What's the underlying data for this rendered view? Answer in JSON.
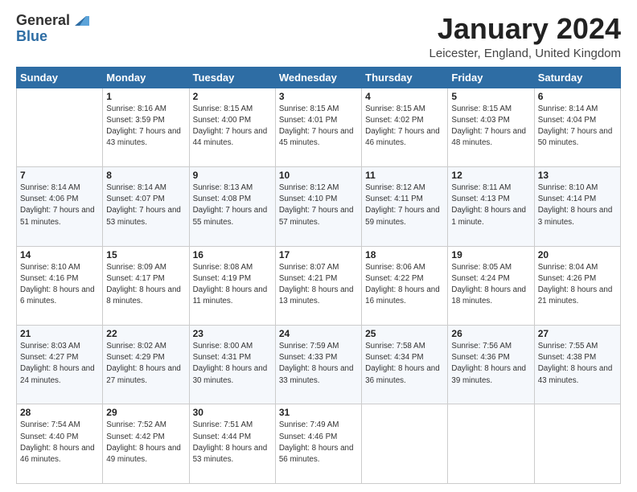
{
  "header": {
    "logo_general": "General",
    "logo_blue": "Blue",
    "month_title": "January 2024",
    "location": "Leicester, England, United Kingdom"
  },
  "weekdays": [
    "Sunday",
    "Monday",
    "Tuesday",
    "Wednesday",
    "Thursday",
    "Friday",
    "Saturday"
  ],
  "weeks": [
    [
      {
        "day": "",
        "sunrise": "",
        "sunset": "",
        "daylight": ""
      },
      {
        "day": "1",
        "sunrise": "Sunrise: 8:16 AM",
        "sunset": "Sunset: 3:59 PM",
        "daylight": "Daylight: 7 hours and 43 minutes."
      },
      {
        "day": "2",
        "sunrise": "Sunrise: 8:15 AM",
        "sunset": "Sunset: 4:00 PM",
        "daylight": "Daylight: 7 hours and 44 minutes."
      },
      {
        "day": "3",
        "sunrise": "Sunrise: 8:15 AM",
        "sunset": "Sunset: 4:01 PM",
        "daylight": "Daylight: 7 hours and 45 minutes."
      },
      {
        "day": "4",
        "sunrise": "Sunrise: 8:15 AM",
        "sunset": "Sunset: 4:02 PM",
        "daylight": "Daylight: 7 hours and 46 minutes."
      },
      {
        "day": "5",
        "sunrise": "Sunrise: 8:15 AM",
        "sunset": "Sunset: 4:03 PM",
        "daylight": "Daylight: 7 hours and 48 minutes."
      },
      {
        "day": "6",
        "sunrise": "Sunrise: 8:14 AM",
        "sunset": "Sunset: 4:04 PM",
        "daylight": "Daylight: 7 hours and 50 minutes."
      }
    ],
    [
      {
        "day": "7",
        "sunrise": "Sunrise: 8:14 AM",
        "sunset": "Sunset: 4:06 PM",
        "daylight": "Daylight: 7 hours and 51 minutes."
      },
      {
        "day": "8",
        "sunrise": "Sunrise: 8:14 AM",
        "sunset": "Sunset: 4:07 PM",
        "daylight": "Daylight: 7 hours and 53 minutes."
      },
      {
        "day": "9",
        "sunrise": "Sunrise: 8:13 AM",
        "sunset": "Sunset: 4:08 PM",
        "daylight": "Daylight: 7 hours and 55 minutes."
      },
      {
        "day": "10",
        "sunrise": "Sunrise: 8:12 AM",
        "sunset": "Sunset: 4:10 PM",
        "daylight": "Daylight: 7 hours and 57 minutes."
      },
      {
        "day": "11",
        "sunrise": "Sunrise: 8:12 AM",
        "sunset": "Sunset: 4:11 PM",
        "daylight": "Daylight: 7 hours and 59 minutes."
      },
      {
        "day": "12",
        "sunrise": "Sunrise: 8:11 AM",
        "sunset": "Sunset: 4:13 PM",
        "daylight": "Daylight: 8 hours and 1 minute."
      },
      {
        "day": "13",
        "sunrise": "Sunrise: 8:10 AM",
        "sunset": "Sunset: 4:14 PM",
        "daylight": "Daylight: 8 hours and 3 minutes."
      }
    ],
    [
      {
        "day": "14",
        "sunrise": "Sunrise: 8:10 AM",
        "sunset": "Sunset: 4:16 PM",
        "daylight": "Daylight: 8 hours and 6 minutes."
      },
      {
        "day": "15",
        "sunrise": "Sunrise: 8:09 AM",
        "sunset": "Sunset: 4:17 PM",
        "daylight": "Daylight: 8 hours and 8 minutes."
      },
      {
        "day": "16",
        "sunrise": "Sunrise: 8:08 AM",
        "sunset": "Sunset: 4:19 PM",
        "daylight": "Daylight: 8 hours and 11 minutes."
      },
      {
        "day": "17",
        "sunrise": "Sunrise: 8:07 AM",
        "sunset": "Sunset: 4:21 PM",
        "daylight": "Daylight: 8 hours and 13 minutes."
      },
      {
        "day": "18",
        "sunrise": "Sunrise: 8:06 AM",
        "sunset": "Sunset: 4:22 PM",
        "daylight": "Daylight: 8 hours and 16 minutes."
      },
      {
        "day": "19",
        "sunrise": "Sunrise: 8:05 AM",
        "sunset": "Sunset: 4:24 PM",
        "daylight": "Daylight: 8 hours and 18 minutes."
      },
      {
        "day": "20",
        "sunrise": "Sunrise: 8:04 AM",
        "sunset": "Sunset: 4:26 PM",
        "daylight": "Daylight: 8 hours and 21 minutes."
      }
    ],
    [
      {
        "day": "21",
        "sunrise": "Sunrise: 8:03 AM",
        "sunset": "Sunset: 4:27 PM",
        "daylight": "Daylight: 8 hours and 24 minutes."
      },
      {
        "day": "22",
        "sunrise": "Sunrise: 8:02 AM",
        "sunset": "Sunset: 4:29 PM",
        "daylight": "Daylight: 8 hours and 27 minutes."
      },
      {
        "day": "23",
        "sunrise": "Sunrise: 8:00 AM",
        "sunset": "Sunset: 4:31 PM",
        "daylight": "Daylight: 8 hours and 30 minutes."
      },
      {
        "day": "24",
        "sunrise": "Sunrise: 7:59 AM",
        "sunset": "Sunset: 4:33 PM",
        "daylight": "Daylight: 8 hours and 33 minutes."
      },
      {
        "day": "25",
        "sunrise": "Sunrise: 7:58 AM",
        "sunset": "Sunset: 4:34 PM",
        "daylight": "Daylight: 8 hours and 36 minutes."
      },
      {
        "day": "26",
        "sunrise": "Sunrise: 7:56 AM",
        "sunset": "Sunset: 4:36 PM",
        "daylight": "Daylight: 8 hours and 39 minutes."
      },
      {
        "day": "27",
        "sunrise": "Sunrise: 7:55 AM",
        "sunset": "Sunset: 4:38 PM",
        "daylight": "Daylight: 8 hours and 43 minutes."
      }
    ],
    [
      {
        "day": "28",
        "sunrise": "Sunrise: 7:54 AM",
        "sunset": "Sunset: 4:40 PM",
        "daylight": "Daylight: 8 hours and 46 minutes."
      },
      {
        "day": "29",
        "sunrise": "Sunrise: 7:52 AM",
        "sunset": "Sunset: 4:42 PM",
        "daylight": "Daylight: 8 hours and 49 minutes."
      },
      {
        "day": "30",
        "sunrise": "Sunrise: 7:51 AM",
        "sunset": "Sunset: 4:44 PM",
        "daylight": "Daylight: 8 hours and 53 minutes."
      },
      {
        "day": "31",
        "sunrise": "Sunrise: 7:49 AM",
        "sunset": "Sunset: 4:46 PM",
        "daylight": "Daylight: 8 hours and 56 minutes."
      },
      {
        "day": "",
        "sunrise": "",
        "sunset": "",
        "daylight": ""
      },
      {
        "day": "",
        "sunrise": "",
        "sunset": "",
        "daylight": ""
      },
      {
        "day": "",
        "sunrise": "",
        "sunset": "",
        "daylight": ""
      }
    ]
  ]
}
